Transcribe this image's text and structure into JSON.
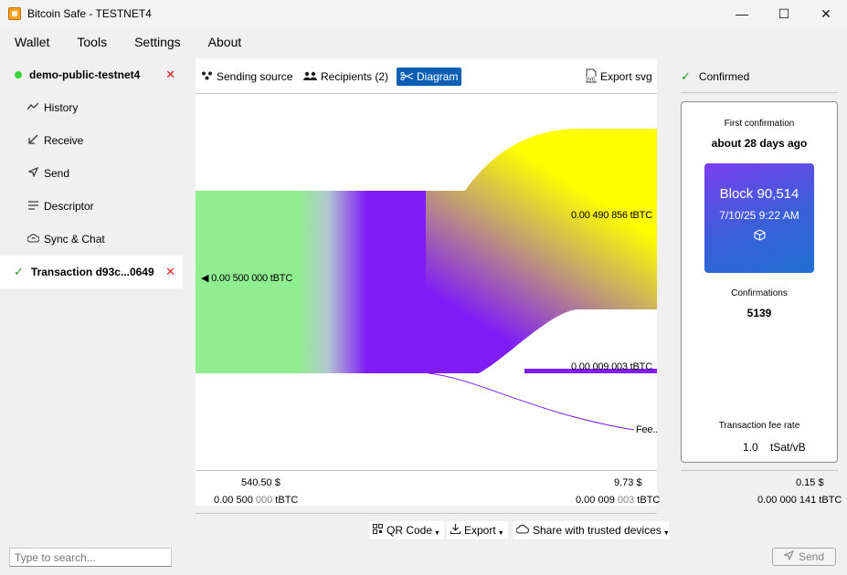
{
  "window": {
    "title": "Bitcoin Safe - TESTNET4",
    "controls": {
      "minimize": "—",
      "maximize": "☐",
      "close": "✕"
    }
  },
  "menu": {
    "wallet": "Wallet",
    "tools": "Tools",
    "settings": "Settings",
    "about": "About"
  },
  "sidebar": {
    "wallet_name": "demo-public-testnet4",
    "items": [
      {
        "label": "History",
        "icon": "chart-line-icon"
      },
      {
        "label": "Receive",
        "icon": "arrow-down-left-icon"
      },
      {
        "label": "Send",
        "icon": "paper-plane-icon"
      },
      {
        "label": "Descriptor",
        "icon": "lines-icon"
      },
      {
        "label": "Sync & Chat",
        "icon": "cloud-sync-icon"
      }
    ],
    "transaction_tab": "Transaction d93c...0649",
    "close_symbol": "✕",
    "search_placeholder": "Type to search..."
  },
  "tabs": {
    "sending_source": "Sending source",
    "recipients": "Recipients (2)",
    "diagram": "Diagram",
    "export_svg": "Export svg"
  },
  "diagram": {
    "input_label": "0.00 500 000 tBTC",
    "output_1_label": "0.00 490 856 tBTC",
    "output_2_label": "0.00 009 003 tBTC",
    "fee_label": "Fee..",
    "input_value_btc": 0.005,
    "outputs_btc": [
      0.00490856,
      9.003e-05
    ],
    "fee_btc": 1.41e-06,
    "colors": {
      "input": "#90ee90",
      "tx": "#7f1cf7",
      "output_main": "#ffff00",
      "fee_line": "#7f1cf7"
    }
  },
  "footer": {
    "input_fiat": "540.50 $",
    "input_btc_a": "0.00 ",
    "input_btc_b": "500",
    "input_btc_c": " 000",
    "input_btc_d": " tBTC",
    "output_fiat": "9.73 $",
    "output_btc_a": "0.00 ",
    "output_btc_b": "009",
    "output_btc_c": " 003",
    "output_btc_d": " tBTC",
    "fee_fiat": "0.15 $",
    "fee_btc_a": "0.00 000 ",
    "fee_btc_b": "141",
    "fee_btc_d": " tBTC"
  },
  "actions": {
    "qr_code": "QR Code",
    "export": "Export",
    "share": "Share with trusted devices",
    "send": "Send"
  },
  "status": {
    "confirmed": "Confirmed",
    "first_confirmation_label": "First confirmation",
    "first_confirmation_value": "about 28 days ago",
    "block_title": "Block 90,514",
    "block_time": "7/10/25 9:22 AM",
    "confirmations_label": "Confirmations",
    "confirmations_value": "5139",
    "fee_rate_label": "Transaction fee rate",
    "fee_rate_value": "1.0",
    "fee_rate_unit": "tSat/vB"
  }
}
